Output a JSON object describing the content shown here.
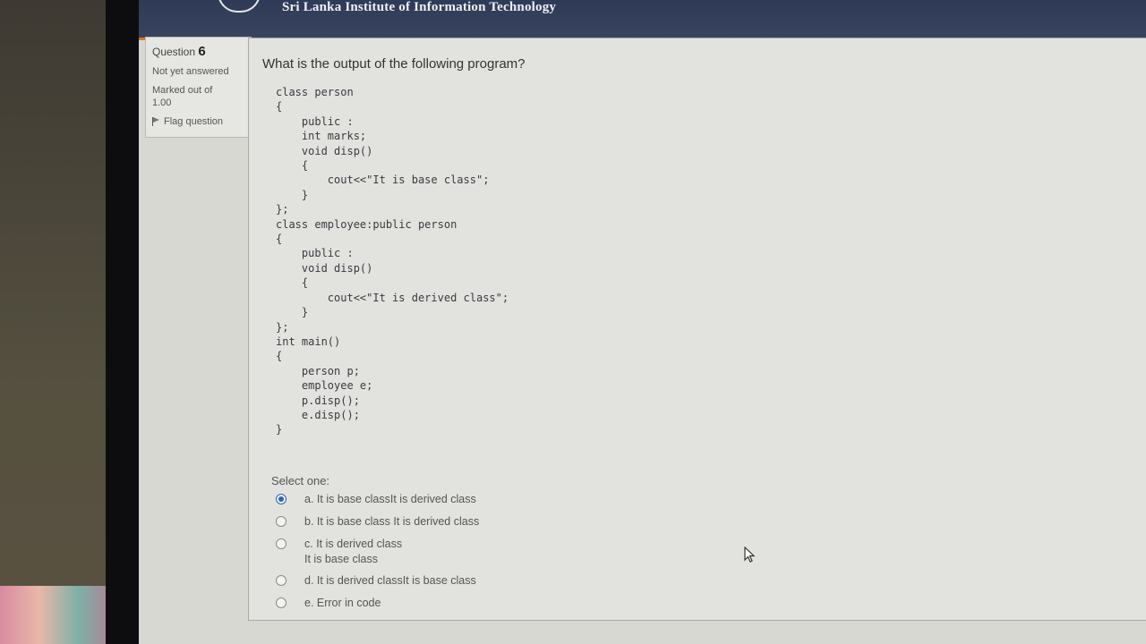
{
  "header": {
    "brand": "Sri Lanka Institute of Information Technology"
  },
  "info": {
    "question_label": "Question",
    "question_number": "6",
    "status": "Not yet answered",
    "marked_label": "Marked out of",
    "marked_value": "1.00",
    "flag_label": "Flag question"
  },
  "question": {
    "text": "What is the output of the following program?",
    "code": "class person\n{\n    public :\n    int marks;\n    void disp()\n    {\n        cout<<\"It is base class\";\n    }\n};\nclass employee:public person\n{\n    public :\n    void disp()\n    {\n        cout<<\"It is derived class\";\n    }\n};\nint main()\n{\n    person p;\n    employee e;\n    p.disp();\n    e.disp();\n}",
    "select_label": "Select one:",
    "options": [
      {
        "label": "a. It is base classIt is derived class",
        "selected": true
      },
      {
        "label": "b. It is base class It is derived class",
        "selected": false
      },
      {
        "label": "c. It is derived class\nIt is base class",
        "selected": false
      },
      {
        "label": "d. It is derived classIt is base class",
        "selected": false
      },
      {
        "label": "e. Error in code",
        "selected": false
      }
    ]
  },
  "colors": {
    "header_bg": "#2e3a57",
    "accent": "#d8742a",
    "radio_selected": "#2d63b8"
  }
}
